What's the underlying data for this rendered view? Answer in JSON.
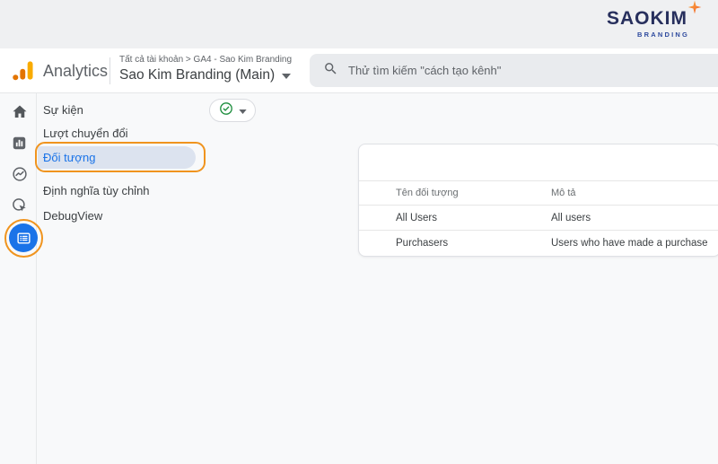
{
  "brand": {
    "name": "SAOKIM",
    "tagline": "BRANDING"
  },
  "header": {
    "app_name": "Analytics",
    "breadcrumb": "Tất cả tài khoản > GA4 - Sao Kim Branding",
    "property_selector": "Sao Kim Branding (Main)",
    "search_placeholder": "Thử tìm kiếm \"cách tạo kênh\""
  },
  "rail": {
    "items": [
      {
        "name": "home"
      },
      {
        "name": "reports"
      },
      {
        "name": "explore"
      },
      {
        "name": "advertising"
      },
      {
        "name": "configure",
        "active": true
      }
    ]
  },
  "nav": {
    "items": [
      {
        "label": "Sự kiện",
        "active": false
      },
      {
        "label": "Lượt chuyển đổi",
        "active": false
      },
      {
        "label": "Đối tượng",
        "active": true
      },
      {
        "label": "Định nghĩa tùy chỉnh",
        "active": false
      },
      {
        "label": "DebugView",
        "active": false
      }
    ]
  },
  "audiences_table": {
    "columns": [
      "Tên đối tượng",
      "Mô tả"
    ],
    "rows": [
      {
        "name": "All Users",
        "description": "All users"
      },
      {
        "name": "Purchasers",
        "description": "Users who have made a purchase"
      }
    ]
  },
  "colors": {
    "accent_blue": "#1a73e8",
    "active_pill_bg": "#dce3ef",
    "annotation_orange": "#f0941e",
    "ga_amber": "#f9ab00",
    "ga_orange": "#e37400",
    "check_green": "#1e8e3e",
    "brand_navy": "#272f5d",
    "brand_blue": "#2e4a9e",
    "brand_star_orange": "#f6921e",
    "topbar_bg": "#eff0f2",
    "content_bg": "#f8f9fa",
    "search_bg": "#e9ebee"
  }
}
